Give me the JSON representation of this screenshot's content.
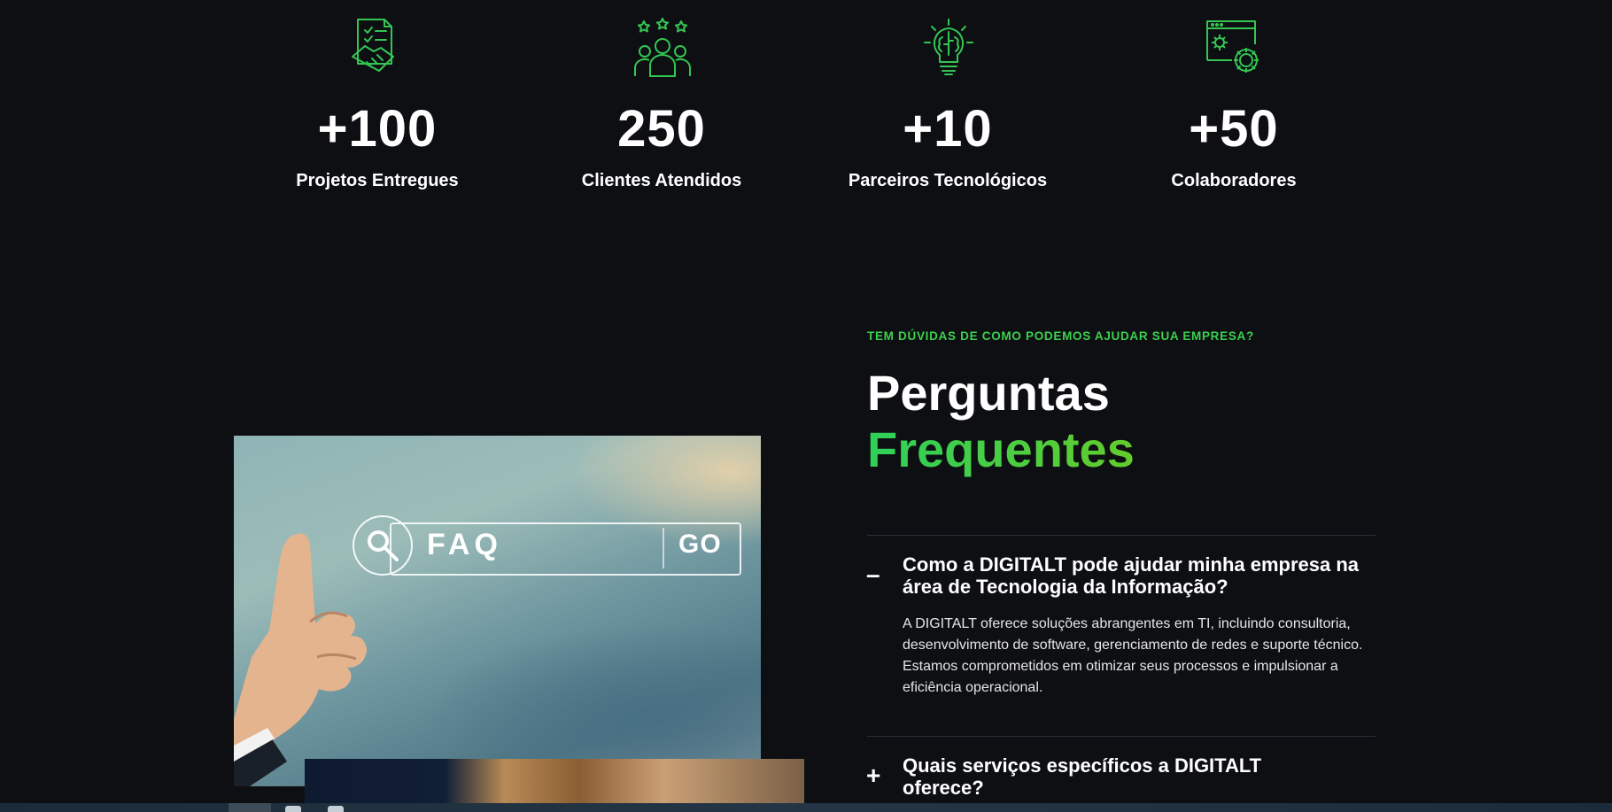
{
  "stats": [
    {
      "icon": "handshake-document-icon",
      "value": "+100",
      "label": "Projetos Entregues"
    },
    {
      "icon": "team-stars-icon",
      "value": "250",
      "label": "Clientes Atendidos"
    },
    {
      "icon": "brain-lightbulb-icon",
      "value": "+10",
      "label": "Parceiros Tecnológicos"
    },
    {
      "icon": "browser-gears-icon",
      "value": "+50",
      "label": "Colaboradores"
    }
  ],
  "image": {
    "search_text": "FAQ",
    "go_text": "GO"
  },
  "faq": {
    "kicker": "TEM DÚVIDAS DE COMO PODEMOS AJUDAR SUA EMPRESA?",
    "title_line1": "Perguntas",
    "title_line2": "Frequentes",
    "items": [
      {
        "sign": "–",
        "question": "Como a DIGITALT pode ajudar minha empresa na área de Tecnologia da Informação?",
        "answer": "A DIGITALT oferece soluções abrangentes em TI, incluindo consultoria, desenvolvimento de software, gerenciamento de redes e suporte técnico. Estamos comprometidos em otimizar seus processos e impulsionar a eficiência operacional."
      },
      {
        "sign": "+",
        "question": "Quais serviços específicos a DIGITALT oferece?"
      }
    ]
  },
  "colors": {
    "accent": "#3cd04e",
    "background": "#0d0f13"
  }
}
